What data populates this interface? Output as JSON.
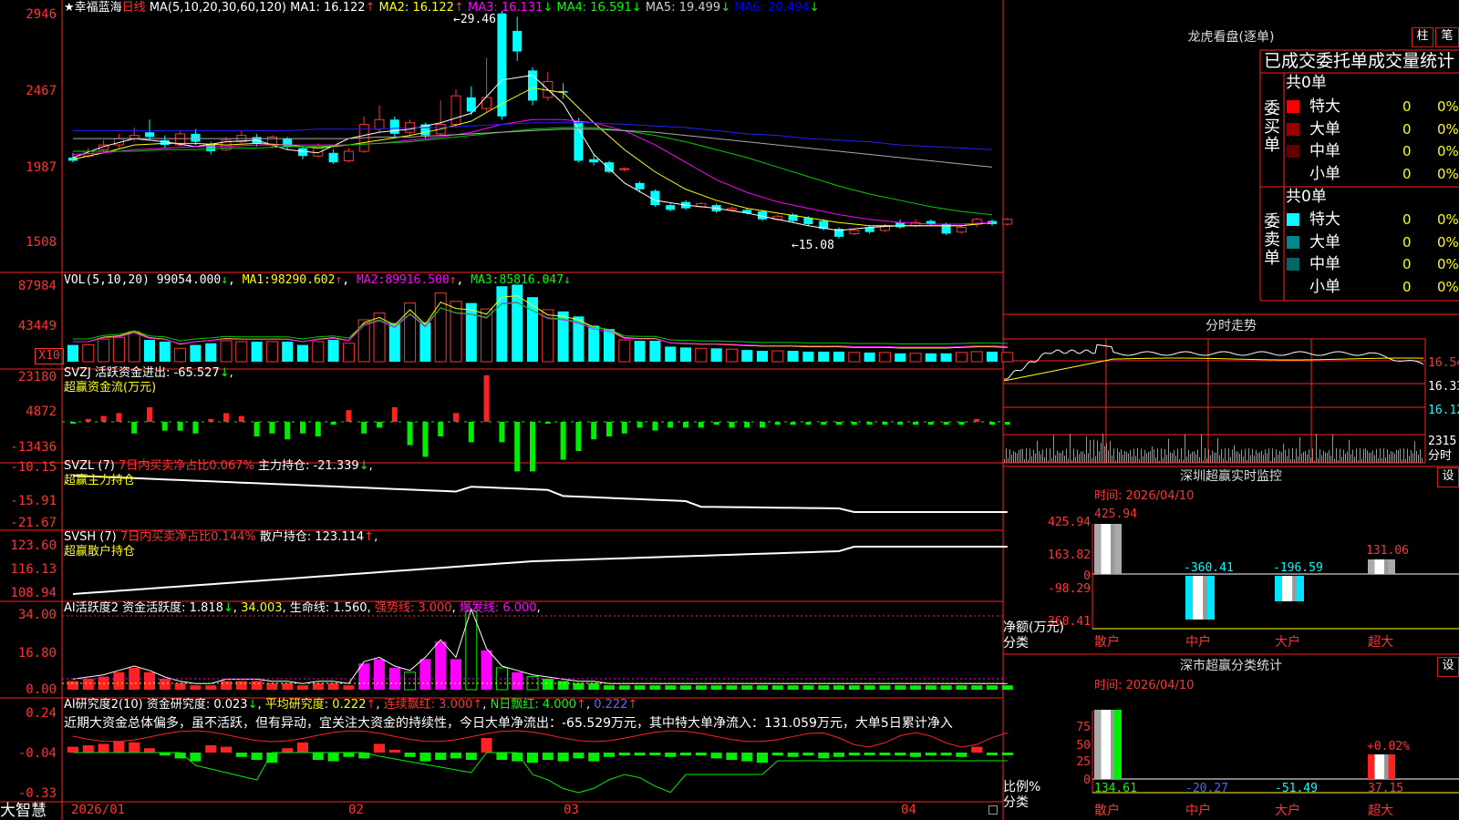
{
  "stock": {
    "name": "★幸福蓝海",
    "period": "日线"
  },
  "main_chart": {
    "ma_header": "MA(5,10,20,30,60,120)",
    "ma": [
      {
        "label": "MA1:",
        "value": "16.122",
        "arrow": "↑",
        "color": "#ffffff"
      },
      {
        "label": "MA2:",
        "value": "16.122",
        "arrow": "↑",
        "color": "#ffff00"
      },
      {
        "label": "MA3:",
        "value": "16.131",
        "arrow": "↓",
        "color": "#ff00ff"
      },
      {
        "label": "MA4:",
        "value": "16.591",
        "arrow": "↓",
        "color": "#00ff00"
      },
      {
        "label": "MA5:",
        "value": "19.499",
        "arrow": "↓",
        "color": "#cccccc"
      },
      {
        "label": "MA6:",
        "value": "20.494",
        "arrow": "↓",
        "color": "#0000ff"
      }
    ],
    "y_labels": [
      "2946",
      "2467",
      "1987",
      "1508"
    ],
    "high_label": "29.46",
    "low_label": "15.08"
  },
  "vol_chart": {
    "title": "VOL(5,10,20)",
    "value": "99054.000",
    "arrow": "↓",
    "ma1": "98290.602",
    "ma1_arrow": "↑",
    "ma2": "89916.500",
    "ma2_arrow": "↑",
    "ma3": "85816.047",
    "ma3_arrow": "↓",
    "y_labels": [
      "87984",
      "43449"
    ],
    "unit": "X10"
  },
  "svzj": {
    "title": "SVZJ",
    "text": "活跃资金进出:",
    "value": "-65.527",
    "arrow": "↓",
    "subtitle": "超赢资金流(万元)",
    "y_labels": [
      "23180",
      "4872",
      "-13436"
    ]
  },
  "svzl": {
    "title": "SVZL (7)",
    "ratio_text": "7日内买卖净占比0.067%",
    "text": "主力持仓:",
    "value": "-21.339",
    "arrow": "↓",
    "subtitle": "超赢主力持仓",
    "y_labels": [
      "-10.15",
      "-15.91",
      "-21.67"
    ]
  },
  "svsh": {
    "title": "SVSH (7)",
    "ratio_text": "7日内买卖净占比0.144%",
    "text": "散户持仓:",
    "value": "123.114",
    "arrow": "↑",
    "subtitle": "超赢散户持仓",
    "y_labels": [
      "123.60",
      "116.13",
      "108.94"
    ]
  },
  "ai_active": {
    "title": "AI活跃度2",
    "a_label": "资金活跃度:",
    "a_val": "1.818",
    "a_arrow": "↓",
    "b_val": "34.003",
    "life_label": "生命线:",
    "life_val": "1.560",
    "strong": "强势线: 3.000",
    "burst": "爆发线: 6.000",
    "y_labels": [
      "34.00",
      "16.80",
      "0.00"
    ]
  },
  "ai_research": {
    "title": "AI研究度2(10)",
    "a_label": "资金研究度:",
    "a_val": "0.023",
    "a_arrow": "↓",
    "avg": "平均研究度: 0.222",
    "avg_arrow": "↑",
    "lianxu": "连续飘红: 3.000",
    "lianxu_arrow": "↑",
    "nday": "N日飘红: 4.000",
    "nday_arrow": "↑",
    "last": "0.222",
    "last_arrow": "↑",
    "comment": "近期大资金总体偏多，虽不活跃，但有异动，宜关注大资金的持续性，今日大单净流出：-65.529万元，其中特大单净流入：131.059万元，大单5日累计净入",
    "y_labels": [
      "0.24",
      "-0.04",
      "-0.33"
    ]
  },
  "x_axis": [
    "2026/01",
    "02",
    "03",
    "04"
  ],
  "brand": "大智慧",
  "dragon": {
    "title": "龙虎看盘(逐单)",
    "btn_zhu": "柱",
    "btn_bi": "笔",
    "header": "已成交委托单成交量统计",
    "buy_label": "委买单",
    "sell_label": "委卖单",
    "total": "共0单",
    "rows": [
      {
        "name": "特大",
        "qty": "0",
        "pct": "0%"
      },
      {
        "name": "大单",
        "qty": "0",
        "pct": "0%"
      },
      {
        "name": "中单",
        "qty": "0",
        "pct": "0%"
      },
      {
        "name": "小单",
        "qty": "0",
        "pct": "0%"
      }
    ],
    "buy_colors": [
      "#ff0000",
      "#990000",
      "#660000",
      "#000000"
    ],
    "sell_colors": [
      "#00ffff",
      "#008888",
      "#006666",
      "#000000"
    ]
  },
  "intraday": {
    "title": "分时走势",
    "y_labels": [
      "16.54",
      "16.33",
      "16.12"
    ],
    "vol_label": "2315",
    "vol_unit": "分时"
  },
  "realtime": {
    "title": "深圳超赢实时监控",
    "btn": "设",
    "time": "时间: 2026/04/10",
    "y_labels": [
      "425.94",
      "163.82",
      "0",
      "-98.29",
      "-360.41"
    ],
    "yunit": "净额(万元)",
    "xunit": "分类",
    "cats": [
      "散户",
      "中户",
      "大户",
      "超大"
    ],
    "values": [
      "425.94",
      "-360.41",
      "-196.59",
      "131.06"
    ]
  },
  "classify": {
    "title": "深市超赢分类统计",
    "btn": "设",
    "time": "时间: 2026/04/10",
    "y_labels": [
      "75",
      "50",
      "25",
      "0"
    ],
    "yunit": "比例%",
    "xunit": "分类",
    "cats": [
      "散户",
      "中户",
      "大户",
      "超大"
    ],
    "values": [
      "134.61",
      "-20.27",
      "-51.49",
      "37.15"
    ],
    "extra": "+0.02%"
  }
}
